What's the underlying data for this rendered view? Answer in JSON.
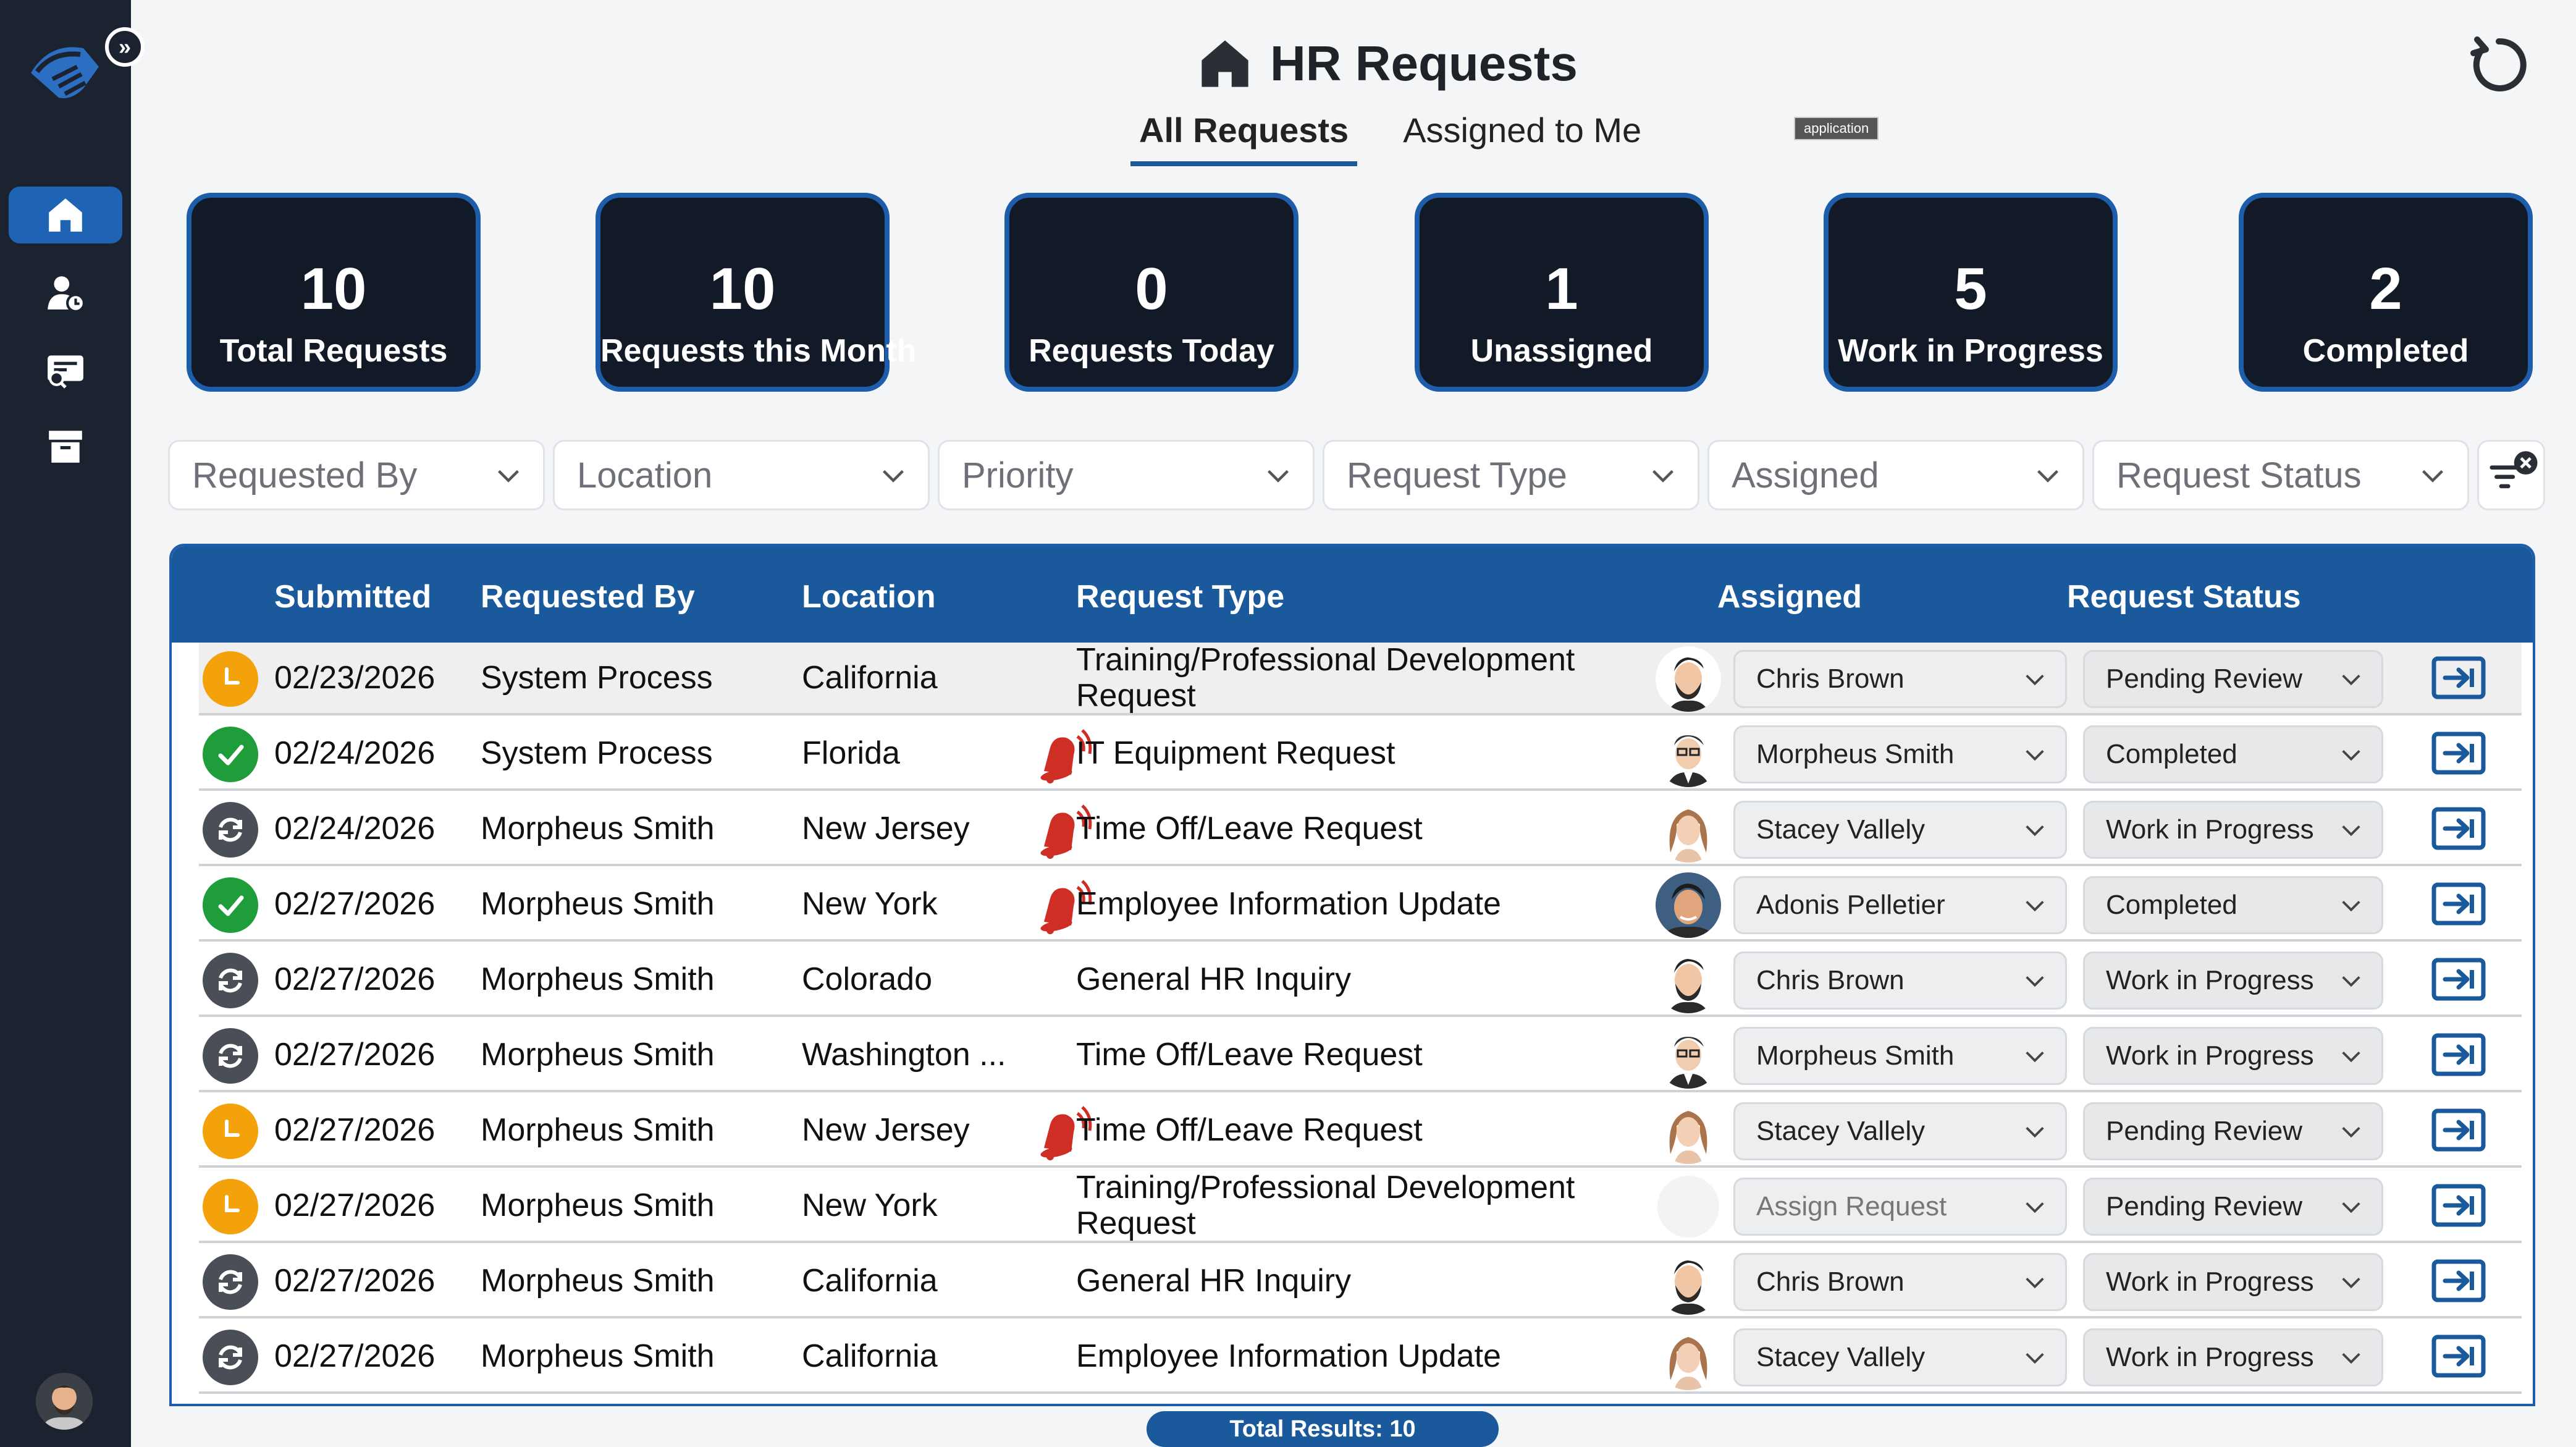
{
  "app": {
    "title": "HR Requests",
    "tabs": [
      {
        "label": "All Requests",
        "active": true
      },
      {
        "label": "Assigned to Me",
        "active": false
      }
    ],
    "tooltip": "application"
  },
  "colors": {
    "sidebar": "#1b2330",
    "accent": "#1a5a9c",
    "card_bg": "#121a27",
    "pending": "#f4a20c",
    "completed": "#1f9d3a",
    "in_progress": "#4a4f57",
    "alarm": "#cf2e25"
  },
  "sidebar": {
    "items": [
      {
        "icon": "home-icon",
        "active": true
      },
      {
        "icon": "user-clock-icon",
        "active": false
      },
      {
        "icon": "ticket-search-icon",
        "active": false
      },
      {
        "icon": "archive-icon",
        "active": false
      }
    ]
  },
  "stats": [
    {
      "value": "10",
      "label": "Total Requests"
    },
    {
      "value": "10",
      "label": "Requests this Month"
    },
    {
      "value": "0",
      "label": "Requests Today"
    },
    {
      "value": "1",
      "label": "Unassigned"
    },
    {
      "value": "5",
      "label": "Work in Progress"
    },
    {
      "value": "2",
      "label": "Completed"
    }
  ],
  "filters": [
    "Requested By",
    "Location",
    "Priority",
    "Request Type",
    "Assigned",
    "Request Status"
  ],
  "table": {
    "headers": {
      "submitted": "Submitted",
      "requested_by": "Requested By",
      "location": "Location",
      "request_type": "Request Type",
      "assigned": "Assigned",
      "request_status": "Request Status"
    },
    "rows": [
      {
        "status_icon": "pending",
        "submitted": "02/23/2026",
        "requested_by": "System Process",
        "location": "California",
        "priority_alert": false,
        "request_type": "Training/Professional Development Request",
        "avatar": "chris",
        "assigned": "Chris Brown",
        "request_status": "Pending Review"
      },
      {
        "status_icon": "completed",
        "submitted": "02/24/2026",
        "requested_by": "System Process",
        "location": "Florida",
        "priority_alert": true,
        "request_type": "IT Equipment Request",
        "avatar": "morpheus",
        "assigned": "Morpheus Smith",
        "request_status": "Completed"
      },
      {
        "status_icon": "in-progress",
        "submitted": "02/24/2026",
        "requested_by": "Morpheus Smith",
        "location": "New Jersey",
        "priority_alert": true,
        "request_type": "Time Off/Leave Request",
        "avatar": "stacey",
        "assigned": "Stacey Vallely",
        "request_status": "Work in Progress"
      },
      {
        "status_icon": "completed",
        "submitted": "02/27/2026",
        "requested_by": "Morpheus Smith",
        "location": "New York",
        "priority_alert": true,
        "request_type": "Employee Information Update",
        "avatar": "adonis",
        "assigned": "Adonis Pelletier",
        "request_status": "Completed"
      },
      {
        "status_icon": "in-progress",
        "submitted": "02/27/2026",
        "requested_by": "Morpheus Smith",
        "location": "Colorado",
        "priority_alert": false,
        "request_type": "General HR Inquiry",
        "avatar": "chris",
        "assigned": "Chris Brown",
        "request_status": "Work in Progress"
      },
      {
        "status_icon": "in-progress",
        "submitted": "02/27/2026",
        "requested_by": "Morpheus Smith",
        "location": "Washington ...",
        "priority_alert": false,
        "request_type": "Time Off/Leave Request",
        "avatar": "morpheus",
        "assigned": "Morpheus Smith",
        "request_status": "Work in Progress"
      },
      {
        "status_icon": "pending",
        "submitted": "02/27/2026",
        "requested_by": "Morpheus Smith",
        "location": "New Jersey",
        "priority_alert": true,
        "request_type": "Time Off/Leave Request",
        "avatar": "stacey",
        "assigned": "Stacey Vallely",
        "request_status": "Pending Review"
      },
      {
        "status_icon": "pending",
        "submitted": "02/27/2026",
        "requested_by": "Morpheus Smith",
        "location": "New York",
        "priority_alert": false,
        "request_type": "Training/Professional Development Request",
        "avatar": "none",
        "assigned": "Assign Request",
        "request_status": "Pending Review"
      },
      {
        "status_icon": "in-progress",
        "submitted": "02/27/2026",
        "requested_by": "Morpheus Smith",
        "location": "California",
        "priority_alert": false,
        "request_type": "General HR Inquiry",
        "avatar": "chris",
        "assigned": "Chris Brown",
        "request_status": "Work in Progress"
      },
      {
        "status_icon": "in-progress",
        "submitted": "02/27/2026",
        "requested_by": "Morpheus Smith",
        "location": "California",
        "priority_alert": false,
        "request_type": "Employee Information Update",
        "avatar": "stacey",
        "assigned": "Stacey Vallely",
        "request_status": "Work in Progress"
      }
    ]
  },
  "footer": {
    "total_results": "Total Results: 10"
  }
}
